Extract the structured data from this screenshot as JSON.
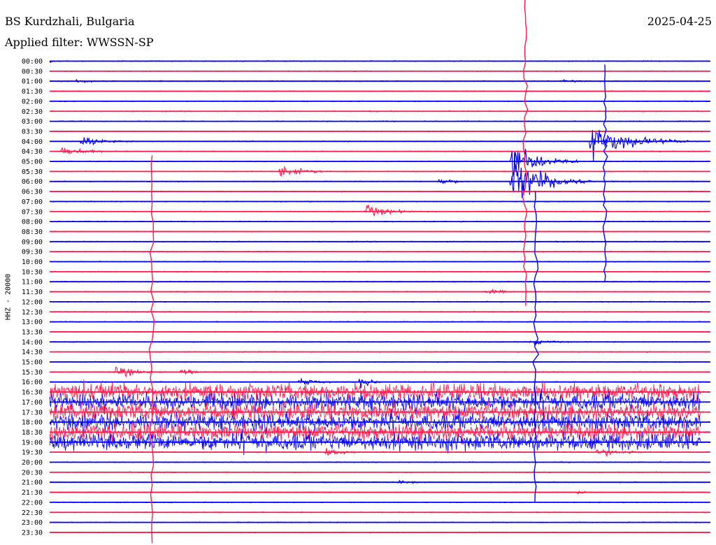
{
  "header": {
    "station": "BS Kurdzhali, Bulgaria",
    "date": "2025-04-25",
    "filter": "Applied filter: WWSSN-SP"
  },
  "chart_data": {
    "type": "line",
    "title": "",
    "xlabel": "",
    "ylabel": "HHZ - 20000",
    "trace_labels": [
      "00:00",
      "00:30",
      "01:00",
      "01:30",
      "02:00",
      "02:30",
      "03:00",
      "03:30",
      "04:00",
      "04:30",
      "05:00",
      "05:30",
      "06:00",
      "06:30",
      "07:00",
      "07:30",
      "08:00",
      "08:30",
      "09:00",
      "09:30",
      "10:00",
      "10:30",
      "11:00",
      "11:30",
      "12:00",
      "12:30",
      "13:00",
      "13:30",
      "14:00",
      "14:30",
      "15:00",
      "15:30",
      "16:00",
      "16:30",
      "17:00",
      "17:30",
      "18:00",
      "18:30",
      "19:00",
      "19:30",
      "20:00",
      "20:30",
      "21:00",
      "21:30",
      "22:00",
      "22:30",
      "23:00",
      "23:30"
    ],
    "trace_minutes": 30,
    "colors": [
      "#0000ff",
      "#ff1a4b"
    ],
    "grid": false,
    "legend": "none",
    "events": [
      {
        "trace": "00:00",
        "t": 0.0,
        "amp": 3,
        "dur": 0.03
      },
      {
        "trace": "01:00",
        "t": 0.04,
        "amp": 4,
        "dur": 0.06
      },
      {
        "trace": "01:00",
        "t": 0.78,
        "amp": 3,
        "dur": 0.04
      },
      {
        "trace": "04:00",
        "t": 0.05,
        "amp": 10,
        "dur": 0.08
      },
      {
        "trace": "04:30",
        "t": 0.02,
        "amp": 9,
        "dur": 0.1
      },
      {
        "trace": "04:00",
        "t": 0.82,
        "amp": 35,
        "dur": 0.15
      },
      {
        "trace": "05:00",
        "t": 0.7,
        "amp": 40,
        "dur": 0.1
      },
      {
        "trace": "05:30",
        "t": 0.35,
        "amp": 13,
        "dur": 0.08
      },
      {
        "trace": "06:00",
        "t": 0.59,
        "amp": 8,
        "dur": 0.05
      },
      {
        "trace": "06:00",
        "t": 0.7,
        "amp": 55,
        "dur": 0.12
      },
      {
        "trace": "07:30",
        "t": 0.48,
        "amp": 14,
        "dur": 0.08
      },
      {
        "trace": "11:30",
        "t": 0.66,
        "amp": 7,
        "dur": 0.05
      },
      {
        "trace": "14:00",
        "t": 0.73,
        "amp": 6,
        "dur": 0.06
      },
      {
        "trace": "15:30",
        "t": 0.1,
        "amp": 12,
        "dur": 0.08
      },
      {
        "trace": "15:30",
        "t": 0.2,
        "amp": 8,
        "dur": 0.04
      },
      {
        "trace": "16:00",
        "t": 0.38,
        "amp": 10,
        "dur": 0.05
      },
      {
        "trace": "16:00",
        "t": 0.47,
        "amp": 14,
        "dur": 0.04
      },
      {
        "trace": "19:30",
        "t": 0.42,
        "amp": 12,
        "dur": 0.05
      },
      {
        "trace": "19:30",
        "t": 0.83,
        "amp": 10,
        "dur": 0.08
      },
      {
        "trace": "21:00",
        "t": 0.53,
        "amp": 4,
        "dur": 0.04
      },
      {
        "trace": "21:30",
        "t": 0.8,
        "amp": 4,
        "dur": 0.03
      }
    ],
    "spikes": [
      {
        "trace": "03:30",
        "t": 0.72,
        "up": 200,
        "down": 250
      },
      {
        "trace": "04:00",
        "t": 0.84,
        "up": 110,
        "down": 200
      },
      {
        "trace": "15:30",
        "t": 0.155,
        "up": 310,
        "down": 245
      },
      {
        "trace": "07:00",
        "t": 0.735,
        "up": 15,
        "down": 430
      }
    ],
    "noise_band": {
      "from": "16:30",
      "to": "19:00",
      "t_start": 0.0,
      "t_end": 0.985,
      "amp": 20
    }
  }
}
